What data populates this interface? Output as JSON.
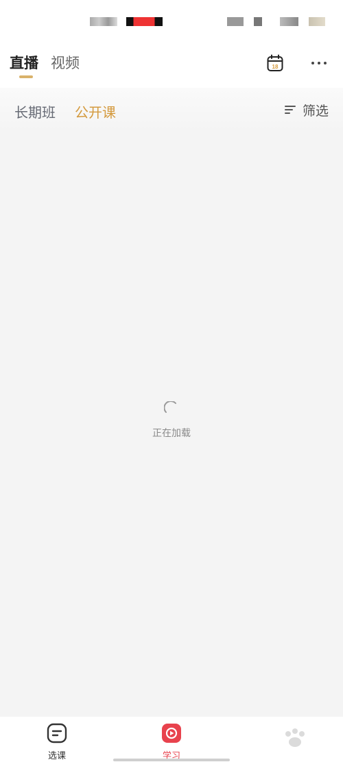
{
  "header": {
    "tabs": [
      {
        "label": "直播",
        "active": true
      },
      {
        "label": "视频",
        "active": false
      }
    ],
    "calendar_day": "18",
    "calendar_icon": "calendar-icon",
    "more_icon": "more-icon"
  },
  "subtabs": {
    "items": [
      {
        "label": "长期班",
        "active": false
      },
      {
        "label": "公开课",
        "active": true
      }
    ],
    "filter_label": "筛选",
    "filter_icon": "filter-icon"
  },
  "loading": {
    "text": "正在加载"
  },
  "tabbar": {
    "items": [
      {
        "label": "选课",
        "icon": "course-select-icon",
        "active": false
      },
      {
        "label": "学习",
        "icon": "study-play-icon",
        "active": true
      }
    ]
  },
  "colors": {
    "accent_gold": "#d49a3e",
    "underline": "#d9b26a",
    "active_red": "#e8424d",
    "background": "#f4f4f4"
  }
}
